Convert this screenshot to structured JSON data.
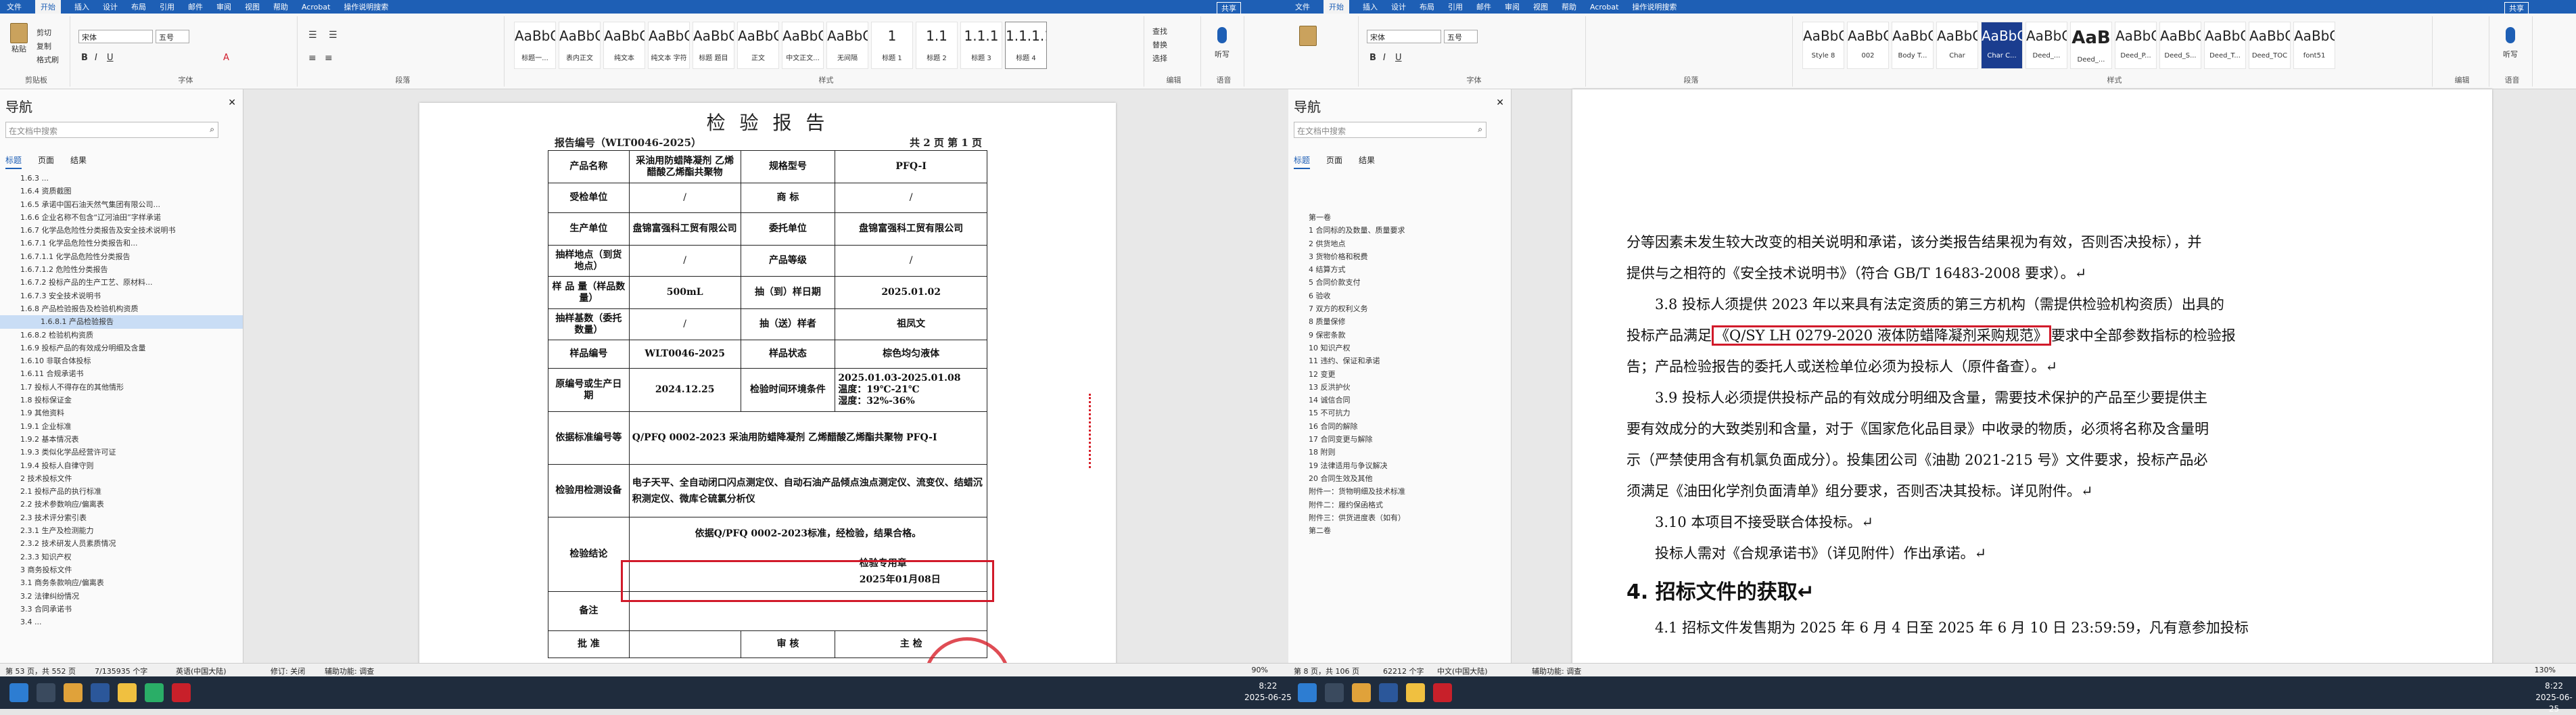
{
  "left_window": {
    "title_icons": [
      "save-icon",
      "undo-icon",
      "redo-icon"
    ],
    "menus": [
      "文件",
      "开始",
      "插入",
      "设计",
      "布局",
      "引用",
      "邮件",
      "审阅",
      "视图",
      "帮助",
      "Acrobat",
      "操作说明搜索"
    ],
    "active_menu": "开始",
    "share": "共享",
    "ribbon": {
      "clipboard": {
        "paste": "粘贴",
        "cut": "剪切",
        "copy": "复制",
        "format_painter": "格式刷",
        "label": "剪贴板"
      },
      "font": {
        "name": "宋体",
        "size": "五号",
        "label": "字体"
      },
      "paragraph_label": "段落",
      "styles": [
        {
          "preview": "AaBbCc",
          "name": "标题一..."
        },
        {
          "preview": "AaBbCc",
          "name": "表内正文"
        },
        {
          "preview": "AaBbCcD",
          "name": "纯文本"
        },
        {
          "preview": "AaBbCcD",
          "name": "纯文本 字符"
        },
        {
          "preview": "AaBbC",
          "name": "标题 题目"
        },
        {
          "preview": "AaBbCcD",
          "name": "正文"
        },
        {
          "preview": "AaBbCcD",
          "name": "中文正文..."
        },
        {
          "preview": "AaBbCcD",
          "name": "无间隔"
        },
        {
          "preview": "1",
          "name": "标题 1"
        },
        {
          "preview": "1.1",
          "name": "标题 2"
        },
        {
          "preview": "1.1.1",
          "name": "标题 3"
        },
        {
          "preview": "1.1.1.1",
          "name": "标题 4"
        }
      ],
      "styles_label": "样式",
      "edit": {
        "find": "查找",
        "replace": "替换",
        "select": "选择",
        "label": "编辑"
      },
      "voice": {
        "btn": "听写",
        "label": "语音"
      }
    },
    "nav": {
      "title": "导航",
      "search_placeholder": "在文档中搜索",
      "tabs": [
        "标题",
        "页面",
        "结果"
      ],
      "items": [
        "1.6.3 ...",
        "1.6.4 资质截图",
        "1.6.5 承诺中国石油天然气集团有限公司...",
        "1.6.6 企业名称不包含“辽河油田”字样承诺",
        "1.6.7 化学品危险性分类报告及安全技术说明书",
        "1.6.7.1 化学品危险性分类报告和...",
        "1.6.7.1.1 化学品危险性分类报告",
        "1.6.7.1.2 危险性分类报告",
        "1.6.7.2 投标产品的生产工艺、原材料...",
        "1.6.7.3 安全技术说明书",
        "1.6.8 产品检验报告及检验机构资质",
        "1.6.8.1 产品检验报告",
        "1.6.8.2 检验机构资质",
        "1.6.9 投标产品的有效成分明细及含量",
        "1.6.10 非联合体投标",
        "1.6.11 合规承诺书",
        "1.7 投标人不得存在的其他情形",
        "1.8 投标保证金",
        "1.9 其他资料",
        "1.9.1 企业标准",
        "1.9.2 基本情况表",
        "1.9.3 类似化学品经营许可证",
        "1.9.4 投标人自律守则",
        "2 技术投标文件",
        "2.1 投标产品的执行标准",
        "2.2 技术参数响应/偏离表",
        "2.3 技术评分索引表",
        "2.3.1 生产及检测能力",
        "2.3.2 技术研发人员素质情况",
        "2.3.3 知识产权",
        "3 商务投标文件",
        "3.1 商务条款响应/偏离表",
        "3.2 法律纠纷情况",
        "3.3 合同承诺书",
        "3.4 ..."
      ],
      "selected_index": 11
    },
    "report": {
      "heading": "检 验 报 告",
      "number": "报告编号（WLT0046-2025）",
      "page_info": "共 2 页 第 1 页",
      "product_name_label": "产品名称",
      "product_name": "采油用防蜡降凝剂 乙烯醋酸乙烯酯共聚物",
      "spec_label": "规格型号",
      "spec": "PFQ-Ⅰ",
      "inspected_unit_label": "受检单位",
      "inspected_unit": "/",
      "brand_label": "商    标",
      "brand": "/",
      "producer_label": "生产单位",
      "producer": "盘锦富强科工贸有限公司",
      "client_label": "委托单位",
      "client": "盘锦富强科工贸有限公司",
      "sampling_place_label": "抽样地点（到货地点）",
      "sampling_place": "/",
      "grade_label": "产品等级",
      "grade": "/",
      "sample_qty_label": "样 品 量（样品数量）",
      "sample_qty": "500mL",
      "arrival_date_label": "抽（到）样日期",
      "arrival_date": "2025.01.02",
      "sample_base_label": "抽样基数（委托数量）",
      "sample_base": "/",
      "sender_label": "抽（送）样者",
      "sender": "祖凤文",
      "sample_no_label": "样品编号",
      "sample_no": "WLT0046-2025",
      "sample_state_label": "样品状态",
      "sample_state": "棕色均匀液体",
      "batch_label": "原编号或生产日期",
      "batch": "2024.12.25",
      "test_time_label": "检验时间环境条件",
      "test_time": "2025.01.03-2025.01.08",
      "temp": "温度：19℃-21℃",
      "humidity": "湿度：32%-36%",
      "basis_label": "依据标准编号等",
      "basis": "Q/PFQ 0002-2023 采油用防蜡降凝剂 乙烯醋酸乙烯酯共聚物 PFQ-Ⅰ",
      "equipment_label": "检验用检测设备",
      "equipment": "电子天平、全自动闭口闪点测定仪、自动石油产品倾点浊点测定仪、流变仪、结蜡沉积测定仪、微库仑硫氯分析仪",
      "conclusion_label": "检验结论",
      "conclusion": "依据Q/PFQ 0002-2023标准，经检验，结果合格。",
      "stamp_text": "检验专用章",
      "sign_date": "2025年01月08日",
      "remark_label": "备注",
      "approve_label": "批    准",
      "review_label": "审    核",
      "main_label": "主    检"
    },
    "status": {
      "page": "第 53 页，共 552 页",
      "words": "7/135935 个字",
      "lang": "英语(中国大陆)",
      "track": "修订: 关闭",
      "access": "辅助功能: 调查"
    }
  },
  "right_window": {
    "menus": [
      "文件",
      "开始",
      "插入",
      "设计",
      "布局",
      "引用",
      "邮件",
      "审阅",
      "视图",
      "帮助",
      "Acrobat",
      "操作说明搜索"
    ],
    "active_menu": "开始",
    "share": "共享",
    "ribbon": {
      "font": {
        "name": "宋体",
        "size": "五号",
        "label": "字体"
      },
      "paragraph_label": "段落",
      "styles": [
        {
          "preview": "AaBbCc",
          "name": "Style 8"
        },
        {
          "preview": "AaBbC",
          "name": "002"
        },
        {
          "preview": "AaBbCcE",
          "name": "Body T..."
        },
        {
          "preview": "AaBbCcE",
          "name": "Char"
        },
        {
          "preview": "AaBbCcE",
          "name": "Char C..."
        },
        {
          "preview": "AaBbC",
          "name": "Deed_..."
        },
        {
          "preview": "AaB",
          "name": "Deed_..."
        },
        {
          "preview": "AaBbC",
          "name": "Deed_P..."
        },
        {
          "preview": "AaBbC",
          "name": "Deed_S..."
        },
        {
          "preview": "AaBbC",
          "name": "Deed_T..."
        },
        {
          "preview": "AaBbCcl",
          "name": "Deed_TOC"
        },
        {
          "preview": "AaBbCcl",
          "name": "font51"
        }
      ],
      "styles_label": "样式",
      "edit_label": "编辑",
      "voice_label": "语音",
      "voice_btn": "听写"
    },
    "nav": {
      "title": "导航",
      "search_placeholder": "在文档中搜索",
      "tabs": [
        "标题",
        "页面",
        "结果"
      ],
      "items": [
        "第一卷",
        "1 合同标的及数量、质量要求",
        "2 供货地点",
        "3 货物价格和税费",
        "4 结算方式",
        "5 合同价款支付",
        "6 验收",
        "7 双方的权利义务",
        "8 质量保修",
        "9 保密条款",
        "10 知识产权",
        "11 违约、保证和承诺",
        "12 变更",
        "13 反洪护伙",
        "14 诚信合同",
        "15 不可抗力",
        "16 合同的解除",
        "17 合同变更与解除",
        "18 附则",
        "19 法律适用与争议解决",
        "20 合同生效及其他",
        "附件一：货物明细及技术标准",
        "附件二：履约保函格式",
        "附件三：供货进度表（如有）",
        "第二卷"
      ]
    },
    "doc": {
      "p1": "分等因素未发生较大改变的相关说明和承诺，该分类报告结果视为有效，否则否决投标），并",
      "p2": "提供与之相符的《安全技术说明书》（符合 GB/T 16483-2008 要求）。↵",
      "p3": "3.8 投标人须提供 2023 年以来具有法定资质的第三方机构（需提供检验机构资质）出具的",
      "p4a": "投标产品满足",
      "p4b": "《Q/SY LH 0279-2020 液体防蜡降凝剂采购规范》",
      "p4c": "要求中全部参数指标的检验报",
      "p5": "告；产品检验报告的委托人或送检单位必须为投标人（原件备查）。↵",
      "p6": "3.9 投标人必须提供投标产品的有效成分明细及含量，需要技术保护的产品至少要提供主",
      "p7": "要有效成分的大致类别和含量，对于《国家危化品目录》中收录的物质，必须将名称及含量明",
      "p8": "示（严禁使用含有机氯负面成分）。投集团公司《油勘 2021-215 号》文件要求，投标产品必",
      "p9": "须满足《油田化学剂负面清单》组分要求，否则否决其投标。详见附件。↵",
      "p10": "3.10 本项目不接受联合体投标。↵",
      "p11": "投标人需对《合规承诺书》（详见附件）作出承诺。↵",
      "h4": "4. 招标文件的获取↵",
      "p12": "4.1 招标文件发售期为 2025 年 6 月 4 日至 2025 年 6 月 10 日 23:59:59，凡有意参加投标"
    },
    "status": {
      "page": "第 8 页，共 106 页",
      "words": "62212 个字",
      "lang": "中文(中国大陆)",
      "access": "辅助功能: 调查"
    }
  },
  "taskbar": {
    "clock_left": {
      "time": "8:22",
      "date": "2025-06-25"
    },
    "clock_right": {
      "time": "8:22",
      "date": "2025-06-25"
    }
  },
  "zoom": {
    "left": "90%",
    "right": "130%"
  },
  "colors": {
    "titlebar": "#1e5fb5",
    "highlight": "#d11a2a",
    "stamp": "#d8202a"
  }
}
